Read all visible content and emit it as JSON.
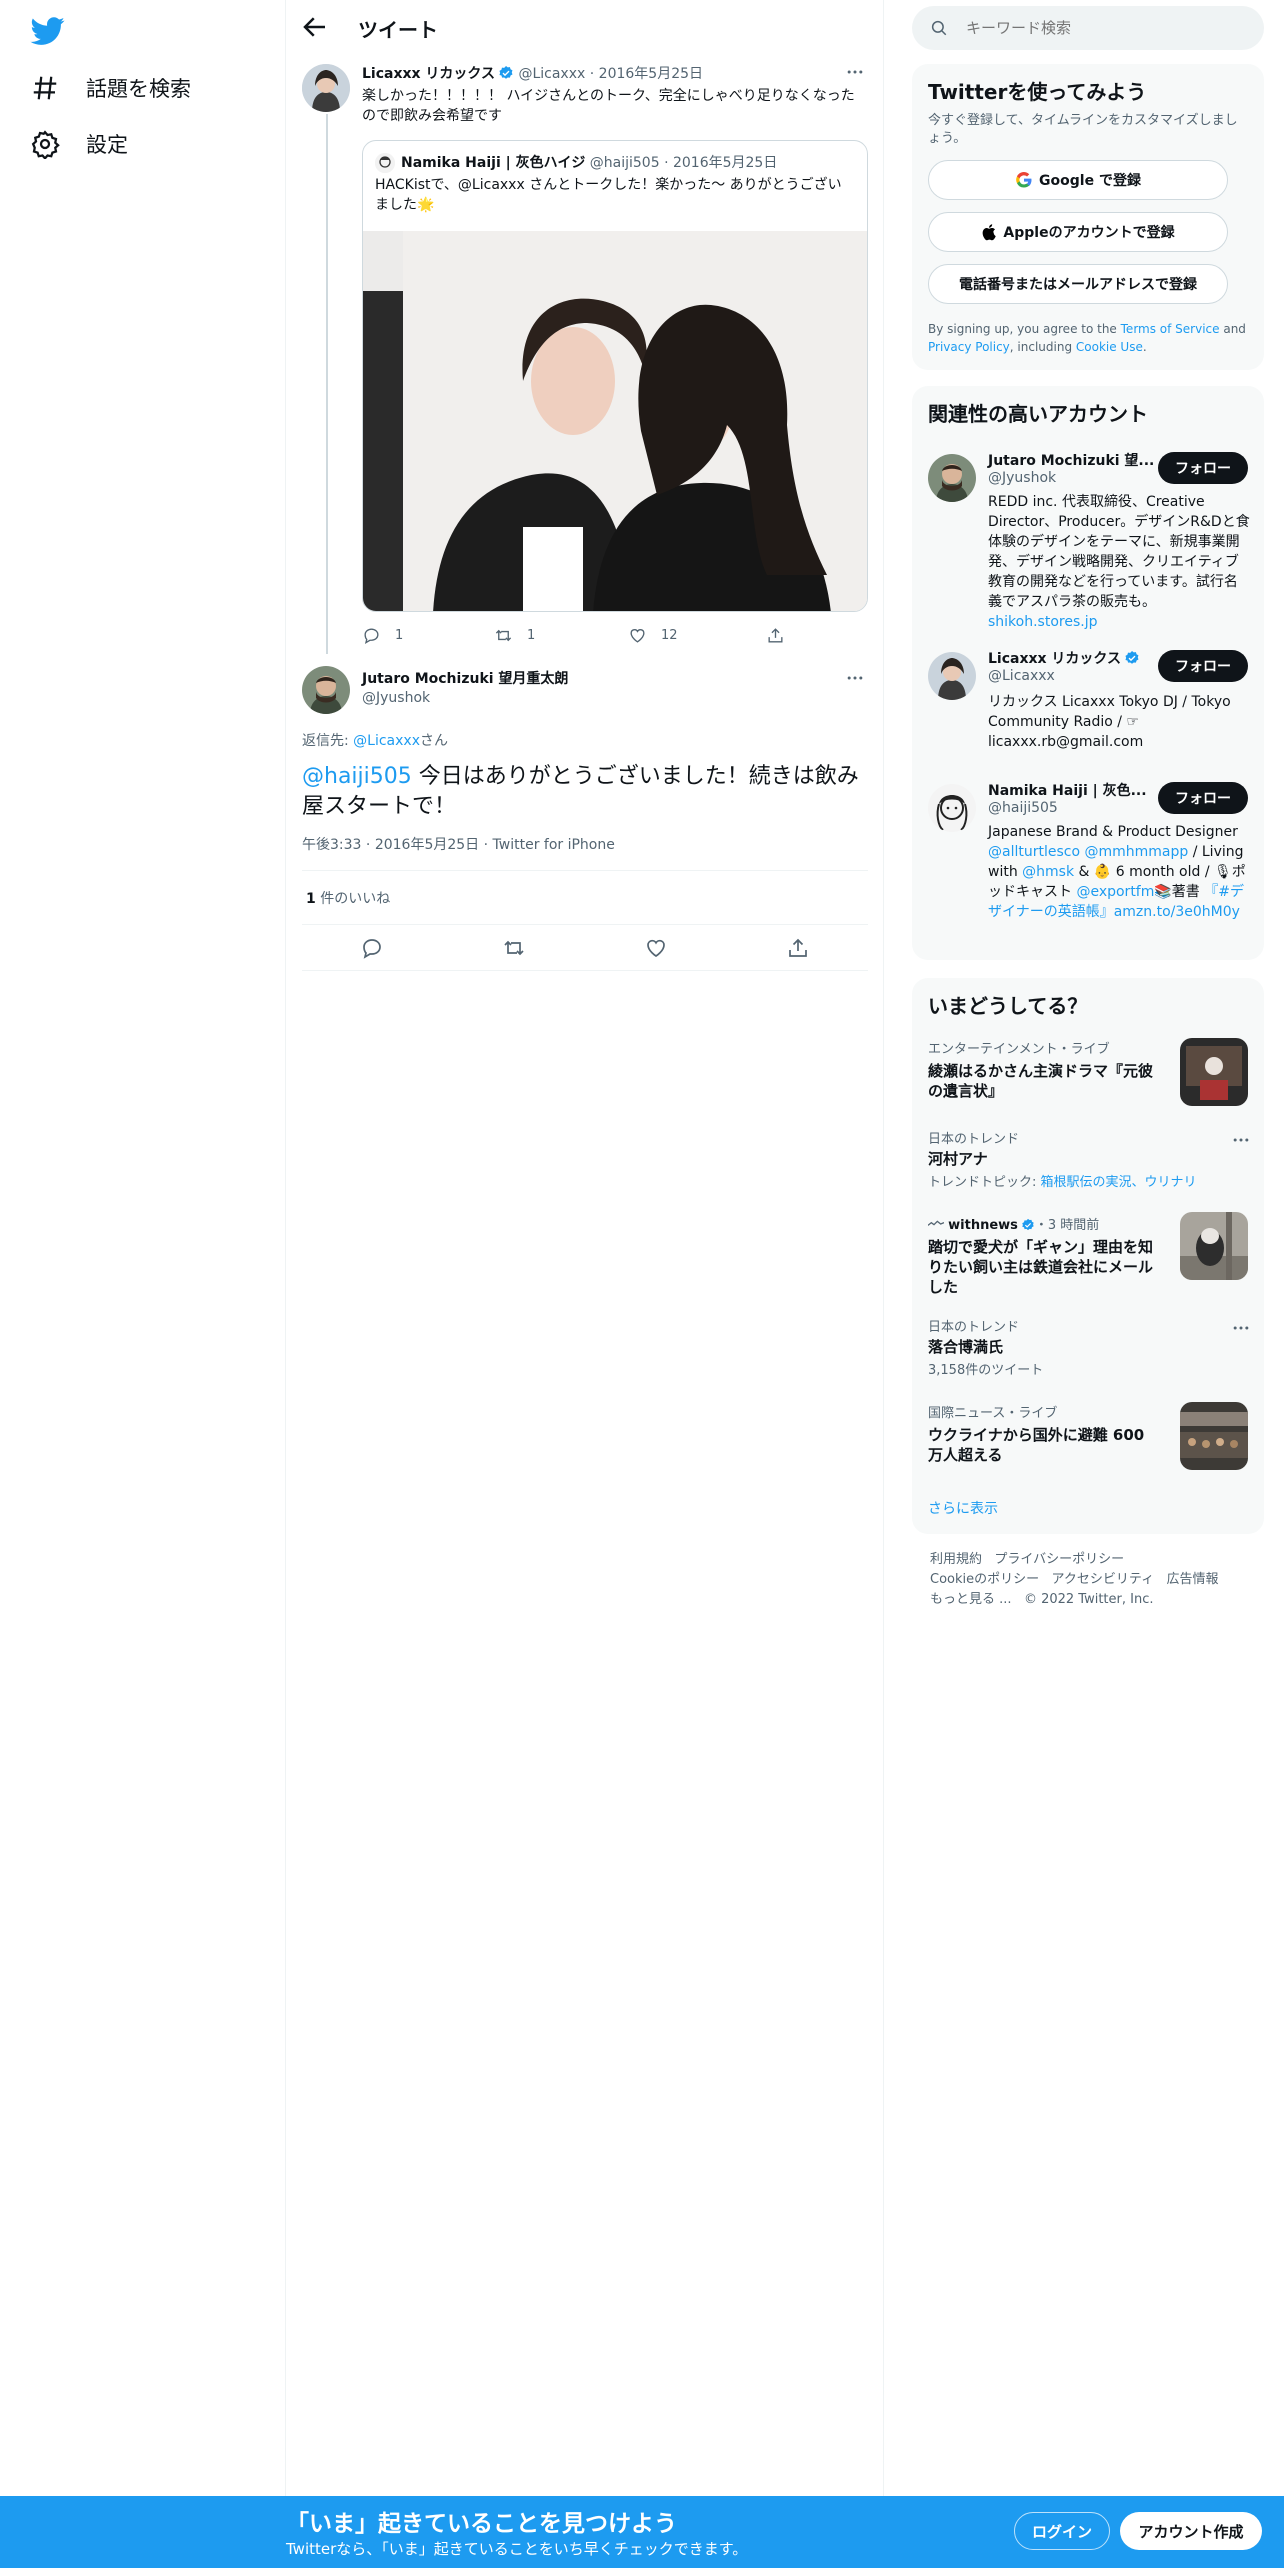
{
  "nav": {
    "explore_label": "話題を検索",
    "settings_label": "設定"
  },
  "header": {
    "title": "ツイート"
  },
  "thread": {
    "parent": {
      "name": "Licaxxx リカックス",
      "handle": "@Licaxxx",
      "date": "2016年5月25日",
      "text": "楽しかった！！！！！ ハイジさんとのトーク、完全にしゃべり足りなくなったので即飲み会希望です",
      "quote": {
        "name": "Namika Haiji | 灰色ハイジ",
        "handle": "@haiji505",
        "date": "2016年5月25日",
        "text": "HACKistで、@Licaxxx さんとトークした！楽かった〜 ありがとうございました🌟"
      },
      "replies": "1",
      "retweets": "1",
      "likes": "12"
    },
    "main": {
      "name": "Jutaro Mochizuki 望月重太朗",
      "handle": "@Jyushok",
      "reply_prefix": "返信先: ",
      "reply_to": "@Licaxxx",
      "reply_suffix": "さん",
      "mention": "@haiji505",
      "text": " 今日はありがとうございました！続きは飲み屋スタートで！",
      "time": "午後3:33",
      "date": "2016年5月25日",
      "client": "Twitter for iPhone",
      "likes_count": "1",
      "likes_label": " 件のいいね"
    }
  },
  "search": {
    "placeholder": "キーワード検索"
  },
  "signup": {
    "title": "Twitterを使ってみよう",
    "sub": "今すぐ登録して、タイムラインをカスタマイズしましょう。",
    "google": "Google で登録",
    "apple": "Appleのアカウントで登録",
    "phone": "電話番号またはメールアドレスで登録",
    "legal_1": "By signing up, you agree to the ",
    "tos": "Terms of Service",
    "legal_2": " and ",
    "privacy": "Privacy Policy",
    "legal_3": ", including ",
    "cookie": "Cookie Use",
    "legal_4": "."
  },
  "related": {
    "title": "関連性の高いアカウント",
    "follow_label": "フォロー",
    "accounts": [
      {
        "name": "Jutaro Mochizuki 望...",
        "handle": "@Jyushok",
        "bio": "REDD inc. 代表取締役、Creative Director、Producer。デザインR&Dと食体験のデザインをテーマに、新規事業開発、デザイン戦略開発、クリエイティブ教育の開発などを行っています。試行名義でアスパラ茶の販売も。",
        "bio_link": "shikoh.stores.jp"
      },
      {
        "name": "Licaxxx リカックス",
        "handle": "@Licaxxx",
        "bio": "リカックス Licaxxx Tokyo DJ / Tokyo Community Radio / ☞ licaxxx.rb@gmail.com"
      },
      {
        "name": "Namika Haiji | 灰色...",
        "handle": "@haiji505",
        "bio_1": "Japanese Brand & Product Designer ",
        "bio_m1": "@allturtlesco",
        "bio_m2": "@mmhmmapp",
        "bio_2": " / Living with ",
        "bio_m3": "@hmsk",
        "bio_3": " & 👶 6 month old / 🎙ポッドキャスト ",
        "bio_m4": "@exportfm",
        "bio_4": "📚著書 ",
        "bio_m5": "『#デザイナーの英語帳』amzn.to/3e0hM0y"
      }
    ]
  },
  "trends": {
    "title": "いまどうしてる？",
    "items": [
      {
        "cat": "エンターテインメント・ライブ",
        "title": "綾瀬はるかさん主演ドラマ『元彼の遺言状』"
      },
      {
        "cat": "日本のトレンド",
        "title": "河村アナ",
        "sub_prefix": "トレンドトピック: ",
        "sub_links": "箱根駅伝の実況、ウリナリ"
      },
      {
        "source": "withnews",
        "time": "・3 時間前",
        "title": "踏切で愛犬が「ギャン」理由を知りたい飼い主は鉄道会社にメールした"
      },
      {
        "cat": "日本のトレンド",
        "title": "落合博満氏",
        "sub": "3,158件のツイート"
      },
      {
        "cat": "国際ニュース・ライブ",
        "title": "ウクライナから国外に避難 600万人超える"
      }
    ],
    "show_more": "さらに表示"
  },
  "footer": {
    "terms": "利用規約",
    "privacy": "プライバシーポリシー",
    "cookie": "Cookieのポリシー",
    "accessibility": "アクセシビリティ",
    "ads": "広告情報",
    "more": "もっと見る ...",
    "copyright": "© 2022 Twitter, Inc."
  },
  "bottombar": {
    "title": "「いま」起きていることを見つけよう",
    "sub": "Twitterなら、「いま」起きていることをいち早くチェックできます。",
    "login": "ログイン",
    "signup": "アカウント作成"
  },
  "colors": {
    "accent": "#1d9bf0",
    "text": "#0f1419",
    "muted": "#536471"
  }
}
